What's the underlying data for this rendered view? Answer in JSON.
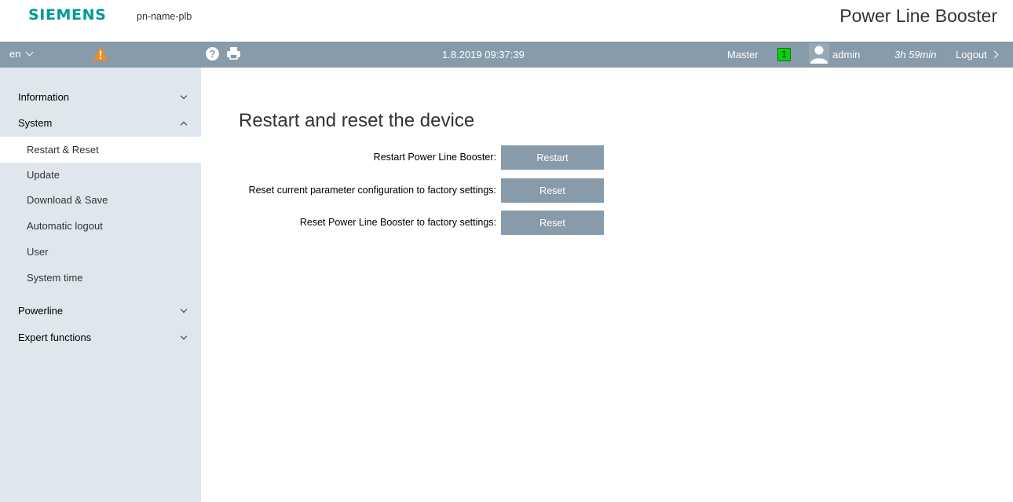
{
  "header": {
    "logo": "SIEMENS",
    "device_name": "pn-name-plb",
    "app_title": "Power Line Booster"
  },
  "topbar": {
    "language": "en",
    "warning_icon": "warning-triangle-icon",
    "help_icon": "help-icon",
    "print_icon": "printer-icon",
    "datetime": "1.8.2019 09:37:39",
    "role": "Master",
    "role_badge": "1",
    "user_icon": "user-avatar-icon",
    "username": "admin",
    "session_time": "3h 59min",
    "logout": "Logout",
    "colors": {
      "bar": "#879baa",
      "badge": "#11cc11",
      "warning": "#f08c1e"
    }
  },
  "sidebar": {
    "information": "Information",
    "system": "System",
    "system_items": [
      "Restart & Reset",
      "Update",
      "Download & Save",
      "Automatic logout",
      "User",
      "System time"
    ],
    "powerline": "Powerline",
    "expert": "Expert functions"
  },
  "main": {
    "title": "Restart and reset the device",
    "rows": [
      {
        "label": "Restart Power Line Booster:",
        "button": "Restart"
      },
      {
        "label": "Reset current parameter configuration to factory settings:",
        "button": "Reset"
      },
      {
        "label": "Reset Power Line Booster to factory settings:",
        "button": "Reset"
      }
    ]
  }
}
